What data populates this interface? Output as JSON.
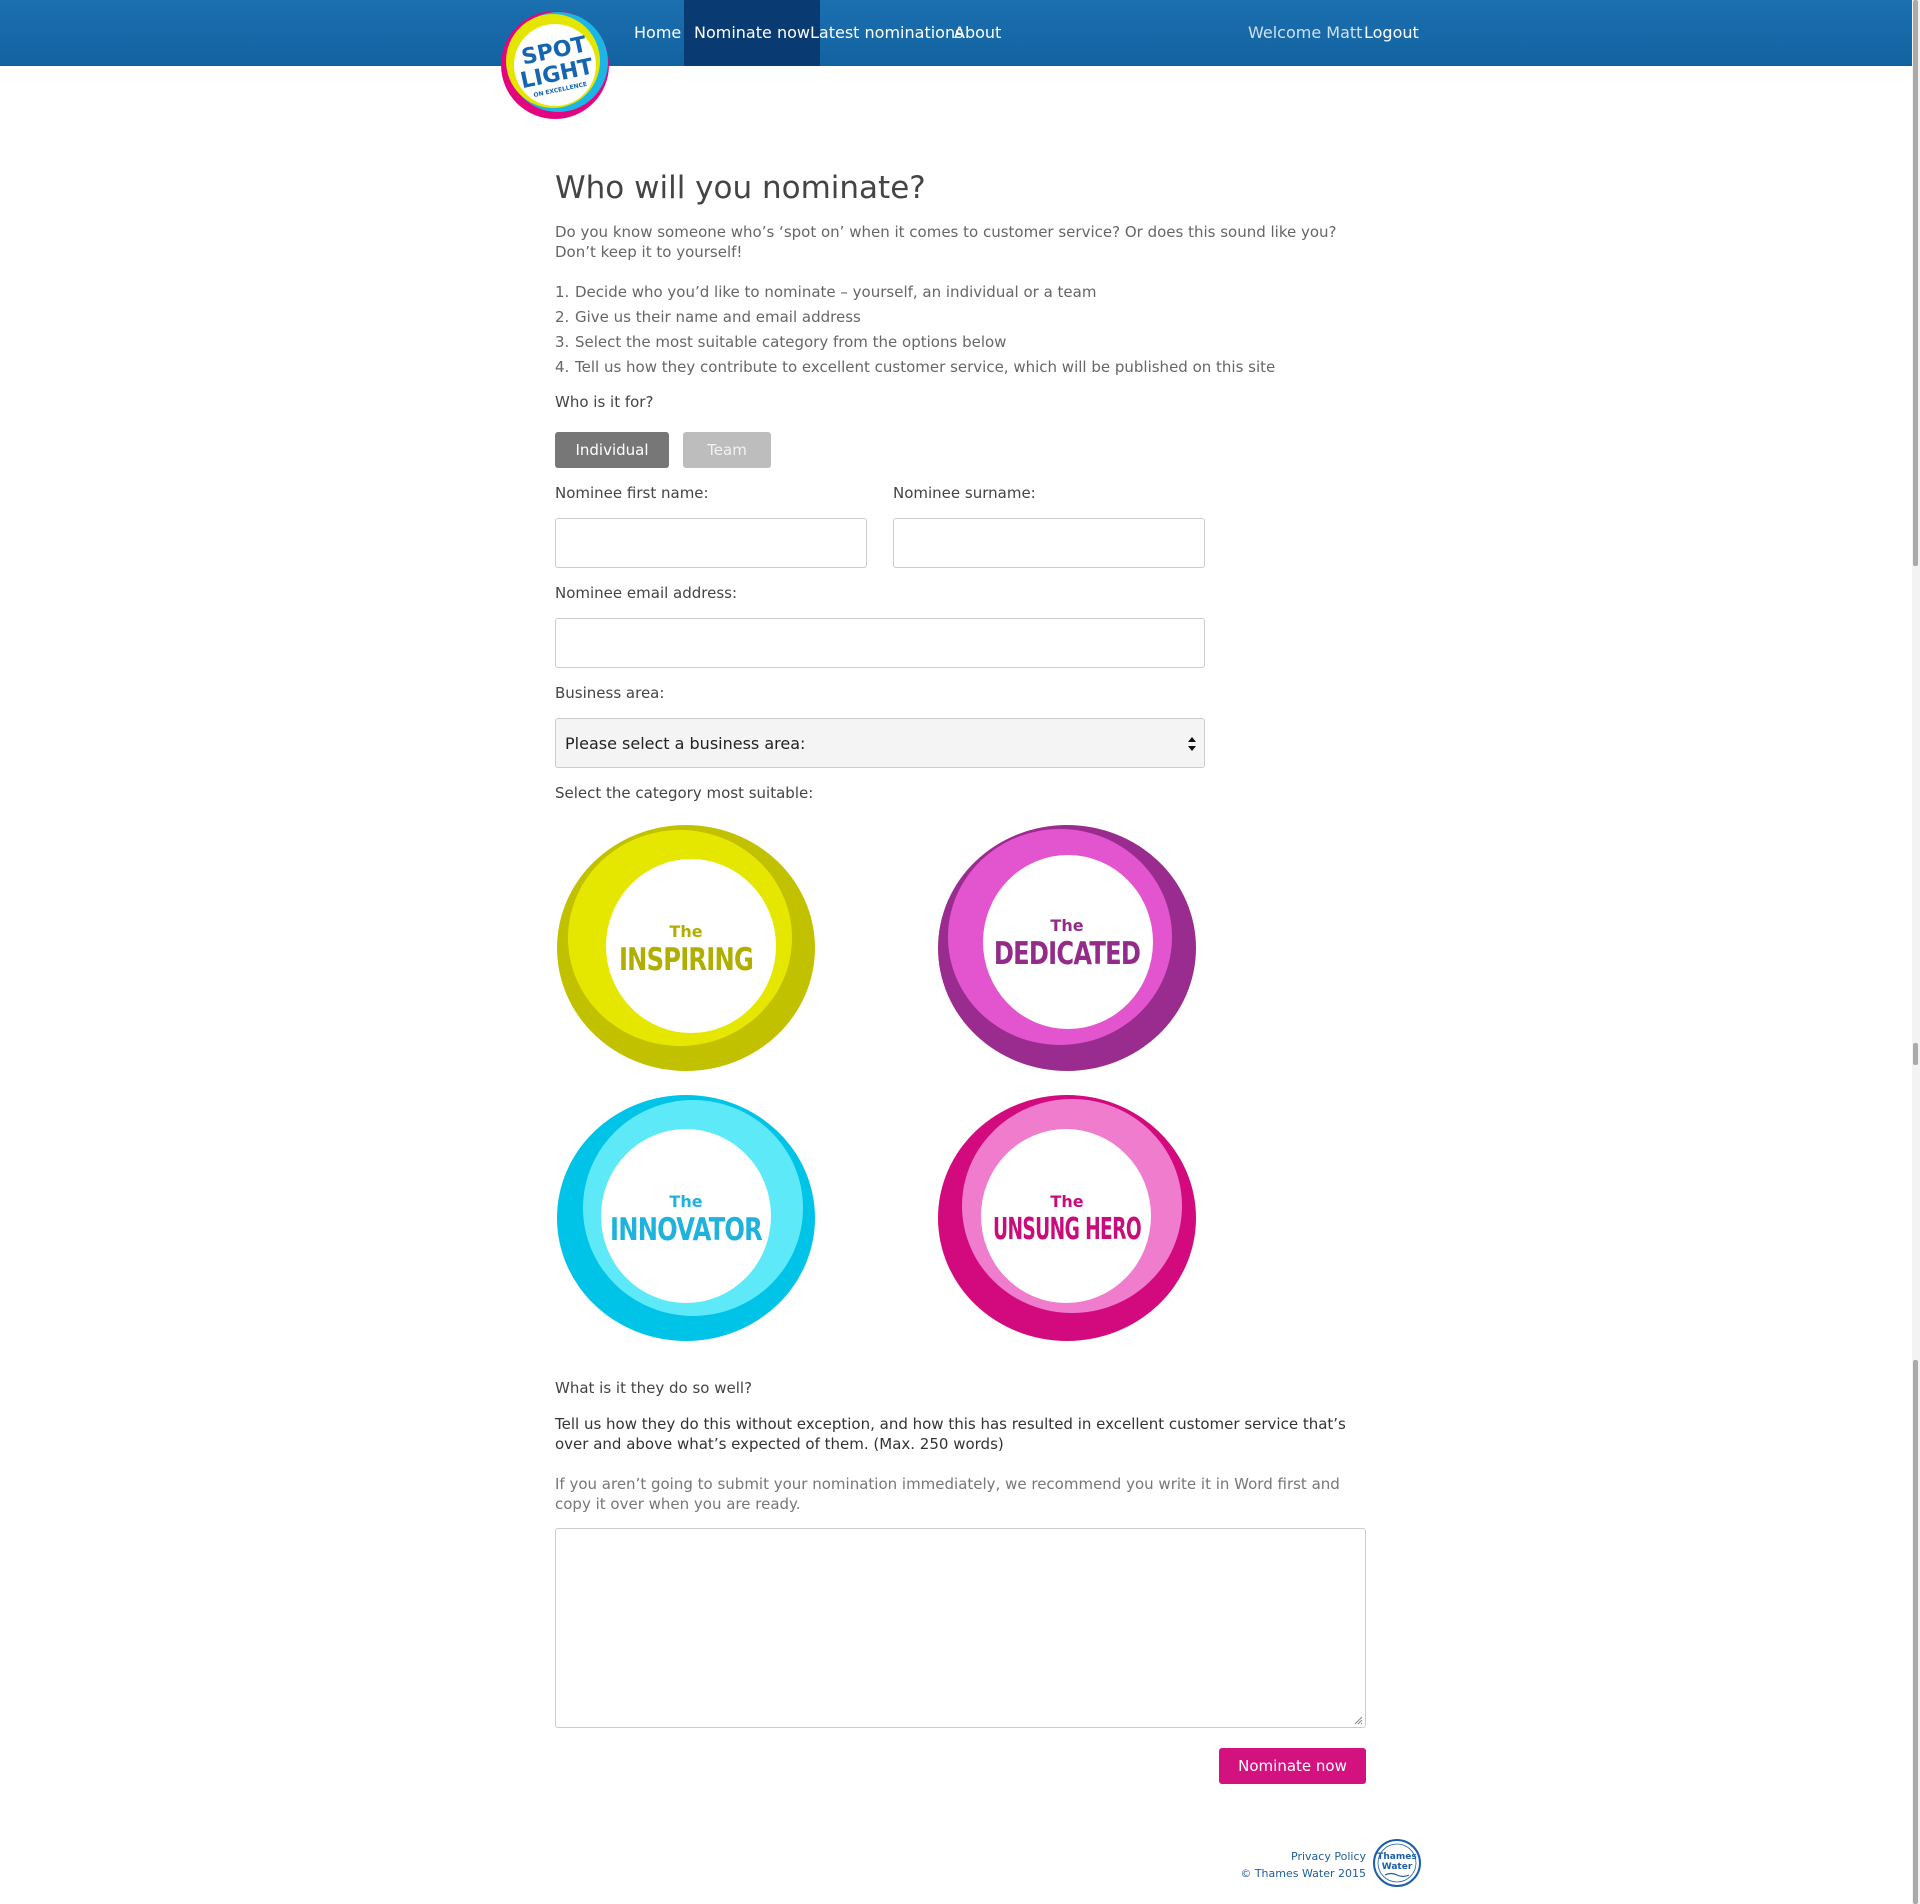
{
  "nav": {
    "items": [
      {
        "label": "Home",
        "active": false
      },
      {
        "label": "Nominate now",
        "active": true
      },
      {
        "label": "Latest nominations",
        "active": false
      },
      {
        "label": "About",
        "active": false
      }
    ],
    "welcome": "Welcome Matt",
    "logout": "Logout"
  },
  "logo": {
    "line1": "SPOT",
    "line2": "LIGHT",
    "tagline": "ON EXCELLENCE"
  },
  "page": {
    "title": "Who will you nominate?",
    "intro": "Do you know someone who’s ‘spot on’ when it comes to customer service? Or does this sound like you? Don’t keep it to yourself!",
    "steps": [
      {
        "num": "1.",
        "text": "Decide who you’d like to nominate – yourself, an individual or a team"
      },
      {
        "num": "2.",
        "text": "Give us their name and email address"
      },
      {
        "num": "3.",
        "text": "Select the most suitable category from the options below"
      },
      {
        "num": "4.",
        "text": "Tell us how they contribute to excellent customer service, which will be published on this site"
      }
    ]
  },
  "form": {
    "who_label": "Who is it for?",
    "toggle_individual": "Individual",
    "toggle_team": "Team",
    "selected_type": "Individual",
    "first_name_label": "Nominee first name:",
    "first_name_value": "",
    "surname_label": "Nominee surname:",
    "surname_value": "",
    "email_label": "Nominee email address:",
    "email_value": "",
    "business_label": "Business area:",
    "business_selected": "Please select a business area:",
    "category_label": "Select the category most suitable:",
    "categories": [
      {
        "the": "The",
        "name": "INSPIRING",
        "colors": {
          "outer": "#c2c100",
          "inner": "#e6e700",
          "text": "#b0ae00"
        }
      },
      {
        "the": "The",
        "name": "DEDICATED",
        "colors": {
          "outer": "#9b2c8f",
          "inner": "#e255cf",
          "text": "#932b88"
        }
      },
      {
        "the": "The",
        "name": "INNOVATOR",
        "colors": {
          "outer": "#00c3e8",
          "inner": "#5de9f7",
          "text": "#1fb2dc"
        }
      },
      {
        "the": "The",
        "name": "UNSUNG HERO",
        "colors": {
          "outer": "#d20a7e",
          "inner": "#ef7ccc",
          "text": "#c80c7c"
        }
      }
    ],
    "question": "What is it they do so well?",
    "instructions": "Tell us how they do this without exception, and how this has resulted in excellent customer service that’s over and above what’s expected of them. (Max. 250 words)",
    "tip": "If you aren’t going to submit your nomination immediately, we recommend you write it in Word first and copy it over when you are ready.",
    "nomination_text": "",
    "submit_label": "Nominate now"
  },
  "footer": {
    "privacy": "Privacy Policy",
    "copyright": "© Thames Water 2015",
    "logo_line1": "Thames",
    "logo_line2": "Water"
  },
  "colors": {
    "header": "#1a6aac",
    "nav_active": "#0a3a72",
    "toggle_on": "#777777",
    "toggle_off": "#bdbdbd",
    "submit": "#d4127f"
  }
}
